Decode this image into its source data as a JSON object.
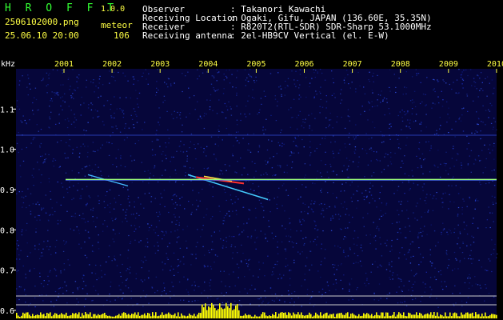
{
  "header": {
    "title": "H R O F F T",
    "version": "1.0.0",
    "filename": "2506102000.png",
    "datetime": "25.06.10 20:00",
    "label": "meteor",
    "count": "106",
    "info": [
      {
        "key": "Observer",
        "value": ": Takanori Kawachi"
      },
      {
        "key": "Receiving Location",
        "value": ": Ogaki, Gifu, JAPAN (136.60E, 35.35N)"
      },
      {
        "key": "Receiver",
        "value": ": R820T2(RTL-SDR) SDR-Sharp 53.1000MHz"
      },
      {
        "key": "Receiving antenna",
        "value": ": 2el-HB9CV Vertical (el. E-W)"
      }
    ]
  },
  "colors": {
    "background": "#000000",
    "plot_bg": "#06063a",
    "noise": "#1a2bb0",
    "carrier": "#9dff7a",
    "header_green": "#33ff33",
    "header_yellow": "#ffff44",
    "bar": "#ffff00"
  },
  "chart_data": {
    "type": "heatmap",
    "unit_label": "kHz",
    "x_ticks": [
      "2001",
      "2002",
      "2003",
      "2004",
      "2005",
      "2006",
      "2007",
      "2008",
      "2009",
      "2010"
    ],
    "y_ticks": [
      "1.1",
      "1.0",
      "0.9",
      "0.8",
      "0.7",
      "0.6"
    ],
    "y_range": [
      0.58,
      1.2
    ],
    "carrier_khz": 0.925,
    "background_line_khz": 1.035,
    "meteor_count": 106
  }
}
